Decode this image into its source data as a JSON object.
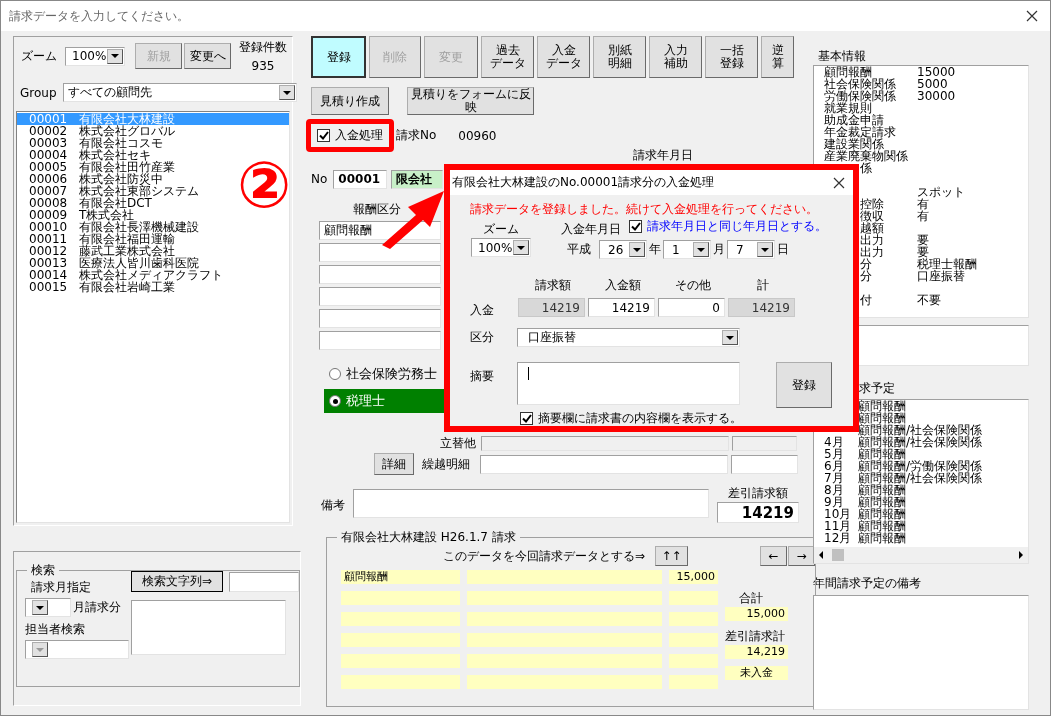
{
  "window": {
    "title": "請求データを入力してください。"
  },
  "left": {
    "zoom_label": "ズーム",
    "zoom": "100%",
    "new_button": {
      "label": "新規",
      "disabled": true
    },
    "change_button": {
      "label": "変更へ",
      "disabled": false
    },
    "count_label": "登録件数",
    "count": "935",
    "group_label": "Group",
    "group": "すべての顧問先",
    "clients": [
      {
        "code": "00001",
        "name": "有限会社大林建設",
        "selected": true
      },
      {
        "code": "00002",
        "name": "株式会社グロバル",
        "selected": false
      },
      {
        "code": "00003",
        "name": "有限会社コスモ",
        "selected": false
      },
      {
        "code": "00004",
        "name": "株式会社セキ",
        "selected": false
      },
      {
        "code": "00005",
        "name": "有限会社田竹産業",
        "selected": false
      },
      {
        "code": "00006",
        "name": "株式会社防災中",
        "selected": false
      },
      {
        "code": "00007",
        "name": "株式会社東部システム",
        "selected": false
      },
      {
        "code": "00008",
        "name": "有限会社DCT",
        "selected": false
      },
      {
        "code": "00009",
        "name": "T株式会社",
        "selected": false
      },
      {
        "code": "00010",
        "name": "有限会社長澤機械建設",
        "selected": false
      },
      {
        "code": "00011",
        "name": "有限会社福田運輸",
        "selected": false
      },
      {
        "code": "00012",
        "name": "藤武工業株式会社",
        "selected": false
      },
      {
        "code": "00013",
        "name": "医療法人皆川歯科医院",
        "selected": false
      },
      {
        "code": "00014",
        "name": "株式会社メディアクラフト",
        "selected": false
      },
      {
        "code": "00015",
        "name": "有限会社岩崎工業",
        "selected": false
      }
    ]
  },
  "search": {
    "title": "検索",
    "month_label": "請求月指定",
    "month_suffix": "月請求分",
    "staff_label": "担当者検索",
    "search_button": "検索文字列⇒"
  },
  "toolbar": [
    {
      "lines": [
        "登録"
      ],
      "disabled": false,
      "default": true
    },
    {
      "lines": [
        "削除"
      ],
      "disabled": true,
      "default": false
    },
    {
      "lines": [
        "変更"
      ],
      "disabled": true,
      "default": false
    },
    {
      "lines": [
        "過去",
        "データ"
      ],
      "disabled": false,
      "default": false
    },
    {
      "lines": [
        "入金",
        "データ"
      ],
      "disabled": false,
      "default": false
    },
    {
      "lines": [
        "別紙",
        "明細"
      ],
      "disabled": false,
      "default": false
    },
    {
      "lines": [
        "入力",
        "補助"
      ],
      "disabled": false,
      "default": false
    },
    {
      "lines": [
        "一括",
        "登録"
      ],
      "disabled": false,
      "default": false
    },
    {
      "lines": [
        "逆",
        "算"
      ],
      "disabled": false,
      "default": false
    }
  ],
  "estimate_buttons": [
    "見積り作成",
    "見積りをフォームに反映"
  ],
  "payment_check": {
    "label": "入金処理",
    "checked": true
  },
  "invoice_no_label": "請求No",
  "invoice_no": "00960",
  "invoice_date_label": "請求年月日",
  "no_label": "No",
  "no": "00001",
  "client_field": "限会社",
  "fee_label": "報酬区分",
  "fee_rows": [
    "顧問報酬"
  ],
  "qualification": [
    {
      "label": "社会保険労務士",
      "selected": false
    },
    {
      "label": "税理士",
      "selected": true
    }
  ],
  "advance_label": "立替他",
  "detail_button": "詳細",
  "carryover_label": "繰越明細",
  "memo_label": "備考",
  "net_label": "差引請求額",
  "net": "14219",
  "previous": {
    "title": "有限会社大林建設 H26.1.7 請求",
    "use_label": "このデータを今回請求データとする⇒",
    "up_button": "↑↑",
    "prev_button": "←",
    "next_button": "→",
    "rows": [
      {
        "item": "顧問報酬",
        "amount": "15,000"
      }
    ],
    "total_label": "合計",
    "total": "15,000",
    "net_label": "差引請求計",
    "net": "14,219",
    "status": "未入金"
  },
  "basic_info": {
    "title": "基本情報",
    "rows": [
      {
        "label": "顧問報酬",
        "value": "15000",
        "kind": "full",
        "gap_before": false
      },
      {
        "label": "社会保険関係",
        "value": "5000",
        "kind": "full",
        "gap_before": false
      },
      {
        "label": "労働保険関係",
        "value": "30000",
        "kind": "full",
        "gap_before": false
      },
      {
        "label": "就業規則",
        "kind": "full",
        "gap_before": false
      },
      {
        "label": "助成金申請",
        "kind": "full",
        "gap_before": false
      },
      {
        "label": "年金裁定請求",
        "kind": "full",
        "gap_before": false
      },
      {
        "label": "建設業関係",
        "kind": "full",
        "gap_before": false
      },
      {
        "label": "産業廃棄物関係",
        "kind": "full",
        "gap_before": false
      },
      {
        "label": "係",
        "kind": "clipped",
        "gap_before": false
      },
      {
        "value": "スポット",
        "kind": "clipped",
        "gap_before": true
      },
      {
        "label": "控除",
        "value": "有",
        "kind": "clipped",
        "gap_before": false
      },
      {
        "label": "徴収",
        "value": "有",
        "kind": "clipped",
        "gap_before": false
      },
      {
        "label": "越額",
        "kind": "clipped",
        "gap_before": false
      },
      {
        "label": "出力",
        "value": "要",
        "kind": "clipped",
        "gap_before": false
      },
      {
        "label": "出力",
        "value": "要",
        "kind": "clipped",
        "gap_before": false
      },
      {
        "label": "分",
        "value": "税理士報酬",
        "kind": "clipped",
        "gap_before": false
      },
      {
        "label": "分",
        "value": "口座振替",
        "kind": "clipped",
        "gap_before": false
      },
      {
        "label": "付",
        "value": "不要",
        "kind": "clipped",
        "gap_before": true
      }
    ]
  },
  "schedule": {
    "title": "求予定",
    "rows": [
      {
        "text": "顧問報酬"
      },
      {
        "text": "顧問報酬"
      },
      {
        "text": "顧問報酬/社会保険関係"
      },
      {
        "month": "4月",
        "text": "顧問報酬/社会保険関係"
      },
      {
        "month": "5月",
        "text": "顧問報酬"
      },
      {
        "month": "6月",
        "text": "顧問報酬/労働保険関係"
      },
      {
        "month": "7月",
        "text": "顧問報酬/社会保険関係"
      },
      {
        "month": "8月",
        "text": "顧問報酬"
      },
      {
        "month": "9月",
        "text": "顧問報酬"
      },
      {
        "month": "10月",
        "text": "顧問報酬"
      },
      {
        "month": "11月",
        "text": "顧問報酬"
      },
      {
        "month": "12月",
        "text": "顧問報酬"
      }
    ]
  },
  "schedule_note_label": "年間請求予定の備考",
  "annotation": {
    "number": "②"
  },
  "dialog": {
    "title": "有限会社大林建設のNo.00001請求分の入金処理",
    "message": "請求データを登録しました。続けて入金処理を行ってください。",
    "zoom_label": "ズーム",
    "zoom": "100%",
    "date_label": "入金年月日",
    "same_date": {
      "label": "請求年月日と同じ年月日とする。",
      "checked": true
    },
    "era": "平成",
    "year": "26",
    "year_unit": "年",
    "month": "1",
    "month_unit": "月",
    "day": "7",
    "day_unit": "日",
    "columns": [
      "請求額",
      "入金額",
      "その他",
      "計"
    ],
    "row_label": "入金",
    "amounts": [
      {
        "value": "14219",
        "readonly": true
      },
      {
        "value": "14219",
        "readonly": false
      },
      {
        "value": "0",
        "readonly": false
      },
      {
        "value": "14219",
        "readonly": true
      }
    ],
    "category_label": "区分",
    "category": "口座振替",
    "summary_label": "摘要",
    "register_button": "登録",
    "show_content": {
      "label": "摘要欄に請求書の内容欄を表示する。",
      "checked": true
    }
  }
}
